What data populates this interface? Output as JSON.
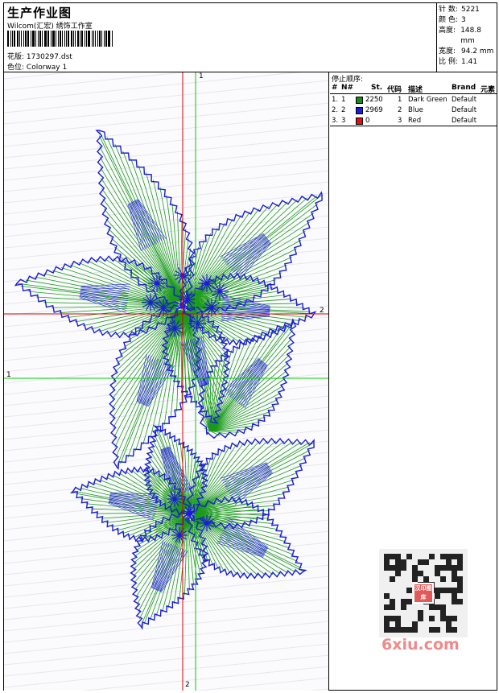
{
  "header": {
    "title": "生产作业图",
    "company": "Wilcom(汇宏) 绣饰工作室",
    "pattern_label": "花版:",
    "pattern_value": "1730297.dst",
    "colorway_label": "色位:",
    "colorway_value": "Colorway 1"
  },
  "stats": [
    {
      "label": "针 数:",
      "value": "5221"
    },
    {
      "label": "颜 色:",
      "value": "3"
    },
    {
      "label": "高度:",
      "value": "148.8 mm"
    },
    {
      "label": "宽度:",
      "value": "94.2 mm"
    },
    {
      "label": "比 例:",
      "value": "1.41"
    }
  ],
  "design": {
    "axis_marks": {
      "top": "1",
      "right": "2",
      "left": "1",
      "bottom": "2"
    },
    "colors": {
      "green": "#1a9a1a",
      "blue": "#1c1cd8",
      "red": "#dd0000",
      "axis_green": "#00cc00"
    }
  },
  "stop_sequence": {
    "title": "停止顺序:",
    "columns": [
      "#",
      "N#",
      "St.",
      "代码",
      "描述",
      "Brand",
      "元素"
    ],
    "rows": [
      {
        "num": "1.",
        "n": "1",
        "color": "#1a8a1a",
        "stitches": "2250",
        "code": "1",
        "desc": "Dark Green",
        "brand": "Default"
      },
      {
        "num": "2.",
        "n": "2",
        "color": "#1c1cd8",
        "stitches": "2969",
        "code": "2",
        "desc": "Blue",
        "brand": "Default"
      },
      {
        "num": "3.",
        "n": "3",
        "color": "#e01010",
        "stitches": "0",
        "code": "3",
        "desc": "Red",
        "brand": "Default"
      }
    ]
  },
  "watermark": {
    "logo_text": "汉印图库",
    "site": "6xiu.com"
  }
}
